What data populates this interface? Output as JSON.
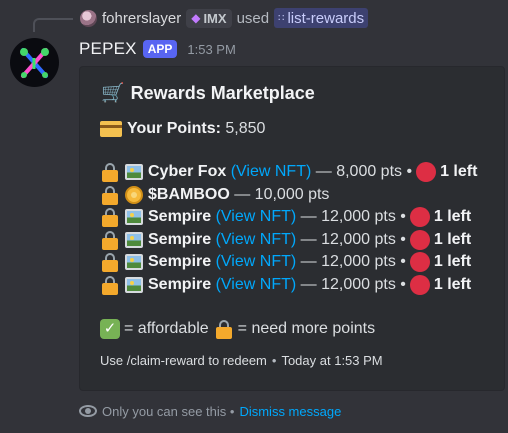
{
  "reply": {
    "user": "fohrerslayer",
    "tag": "IMX",
    "verb": "used",
    "command": "list-rewards"
  },
  "message": {
    "author": "PEPEX",
    "badge": "APP",
    "time": "1:53 PM"
  },
  "embed": {
    "title": "Rewards Marketplace",
    "points_label": "Your Points:",
    "points_value": "5,850",
    "rewards": [
      {
        "name": "Cyber Fox",
        "link": "(View NFT)",
        "price": "— 8,000 pts •",
        "left": "1 left",
        "icon": "framed-picture-icon"
      },
      {
        "name": "$BAMBOO",
        "link": "",
        "price": "— 10,000 pts",
        "left": "",
        "icon": "coin-icon"
      },
      {
        "name": "Sempire",
        "link": "(View NFT)",
        "price": "— 12,000 pts •",
        "left": "1 left",
        "icon": "framed-picture-icon"
      },
      {
        "name": "Sempire",
        "link": "(View NFT)",
        "price": "— 12,000 pts •",
        "left": "1 left",
        "icon": "framed-picture-icon"
      },
      {
        "name": "Sempire",
        "link": "(View NFT)",
        "price": "— 12,000 pts •",
        "left": "1 left",
        "icon": "framed-picture-icon"
      },
      {
        "name": "Sempire",
        "link": "(View NFT)",
        "price": "— 12,000 pts •",
        "left": "1 left",
        "icon": "framed-picture-icon"
      }
    ],
    "legend_affordable": "= affordable",
    "legend_locked": "= need more points",
    "footer_text": "Use /claim-reward to redeem",
    "footer_sep": "•",
    "footer_time": "Today at 1:53 PM"
  },
  "ephemeral": {
    "text": "Only you can see this •",
    "dismiss": "Dismiss message"
  },
  "colors": {
    "background": "#323339",
    "embed": "#2b2d31",
    "link": "#00a8fc",
    "app_badge": "#5865f2"
  }
}
